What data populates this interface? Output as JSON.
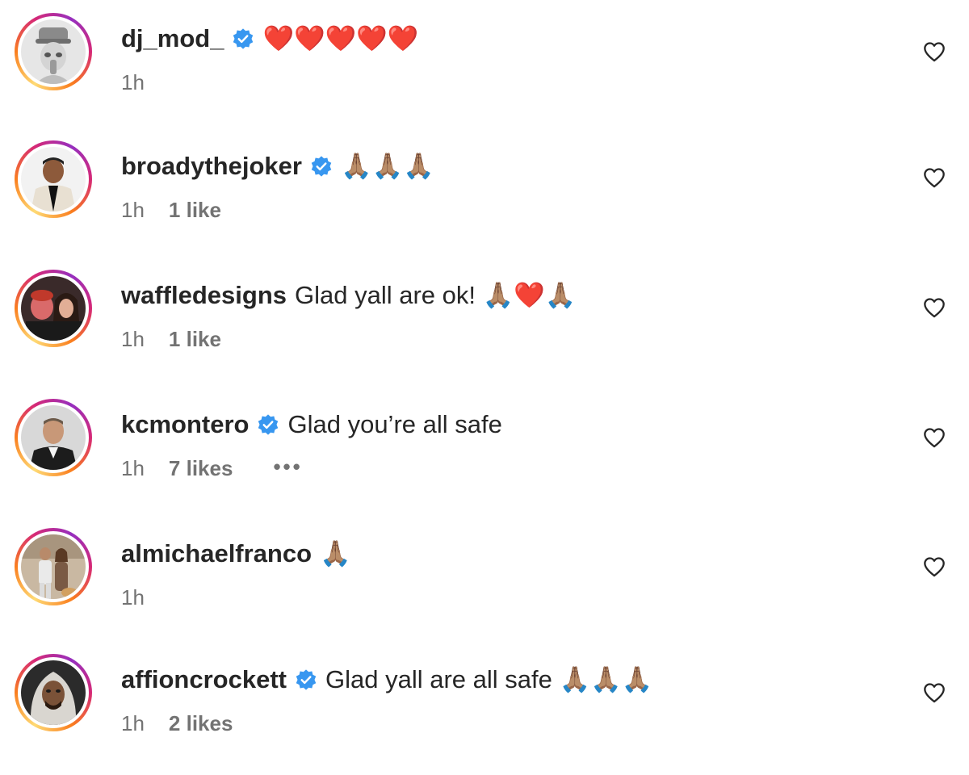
{
  "comments": [
    {
      "username": "dj_mod_",
      "verified": true,
      "text": "❤️❤️❤️❤️❤️",
      "time": "1h",
      "likes": ""
    },
    {
      "username": "broadythejoker",
      "verified": true,
      "text": "🙏🏽🙏🏽🙏🏽",
      "time": "1h",
      "likes": "1 like"
    },
    {
      "username": "waffledesigns",
      "verified": false,
      "text": "Glad yall are ok! 🙏🏽❤️🙏🏽",
      "time": "1h",
      "likes": "1 like"
    },
    {
      "username": "kcmontero",
      "verified": true,
      "text": "Glad you’re all safe",
      "time": "1h",
      "likes": "7 likes",
      "more": "•••"
    },
    {
      "username": "almichaelfranco",
      "verified": false,
      "text": "🙏🏽",
      "time": "1h",
      "likes": ""
    },
    {
      "username": "affioncrockett",
      "verified": true,
      "text": "Glad yall are all safe 🙏🏽🙏🏽🙏🏽",
      "time": "1h",
      "likes": "2 likes"
    }
  ],
  "icons": {
    "verified": "verified-badge-icon",
    "like": "heart-outline-icon",
    "more": "more-options-icon"
  },
  "colors": {
    "verified": "#3897f0",
    "heart_emoji": "#e0245e",
    "prayer_emoji": "#c8a07a",
    "secondary_text": "#737373"
  }
}
